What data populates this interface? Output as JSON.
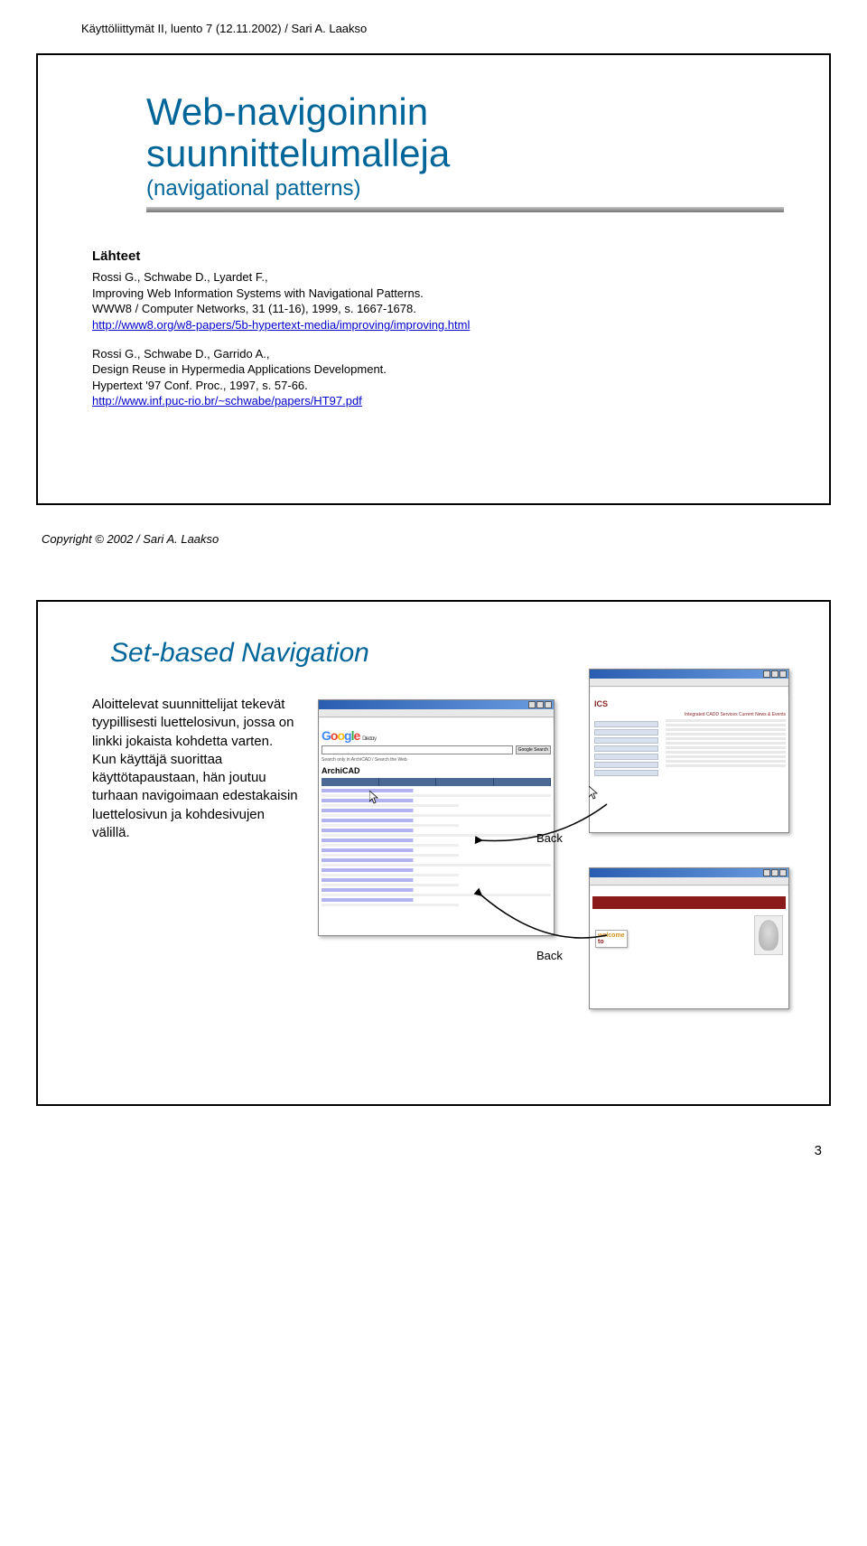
{
  "header": "Käyttöliittymät II, luento 7 (12.11.2002) / Sari A. Laakso",
  "slide1": {
    "title_line1": "Web-navigoinnin",
    "title_line2": "suunnittelumalleja",
    "subtitle": "(navigational patterns)",
    "sources_label": "Lähteet",
    "ref1_text": "Rossi G., Schwabe D., Lyardet F.,\nImproving Web Information Systems with Navigational Patterns.\nWWW8 / Computer Networks, 31 (11-16), 1999, s. 1667-1678.",
    "ref1_link": "http://www8.org/w8-papers/5b-hypertext-media/improving/improving.html",
    "ref2_text": "Rossi G., Schwabe D., Garrido A.,\nDesign Reuse in Hypermedia Applications Development.\nHypertext '97 Conf. Proc., 1997, s. 57-66.",
    "ref2_link": "http://www.inf.puc-rio.br/~schwabe/papers/HT97.pdf"
  },
  "copyright": "Copyright © 2002 / Sari A. Laakso",
  "slide2": {
    "title": "Set-based Navigation",
    "paragraph": "Aloittelevat suunnittelijat tekevät tyypillisesti luettelosivun, jossa on linkki jokaista kohdetta varten. Kun käyttäjä suorittaa käyttötapaustaan, hän joutuu turhaan navigoimaan edestakaisin luettelosivun ja kohdesivujen välillä.",
    "back_label_1": "Back",
    "back_label_2": "Back",
    "google": {
      "directory_label": "Directory",
      "category": "ArchiCAD",
      "search_hint": "Search only in ArchiCAD / Search the Web",
      "button": "Google Search"
    },
    "ics": {
      "logo": "ICS",
      "headline": "Integrated CADD Services Current News & Events"
    },
    "objects": {
      "welcome_1": "welcome",
      "welcome_2": "to"
    }
  },
  "page_number": "3"
}
